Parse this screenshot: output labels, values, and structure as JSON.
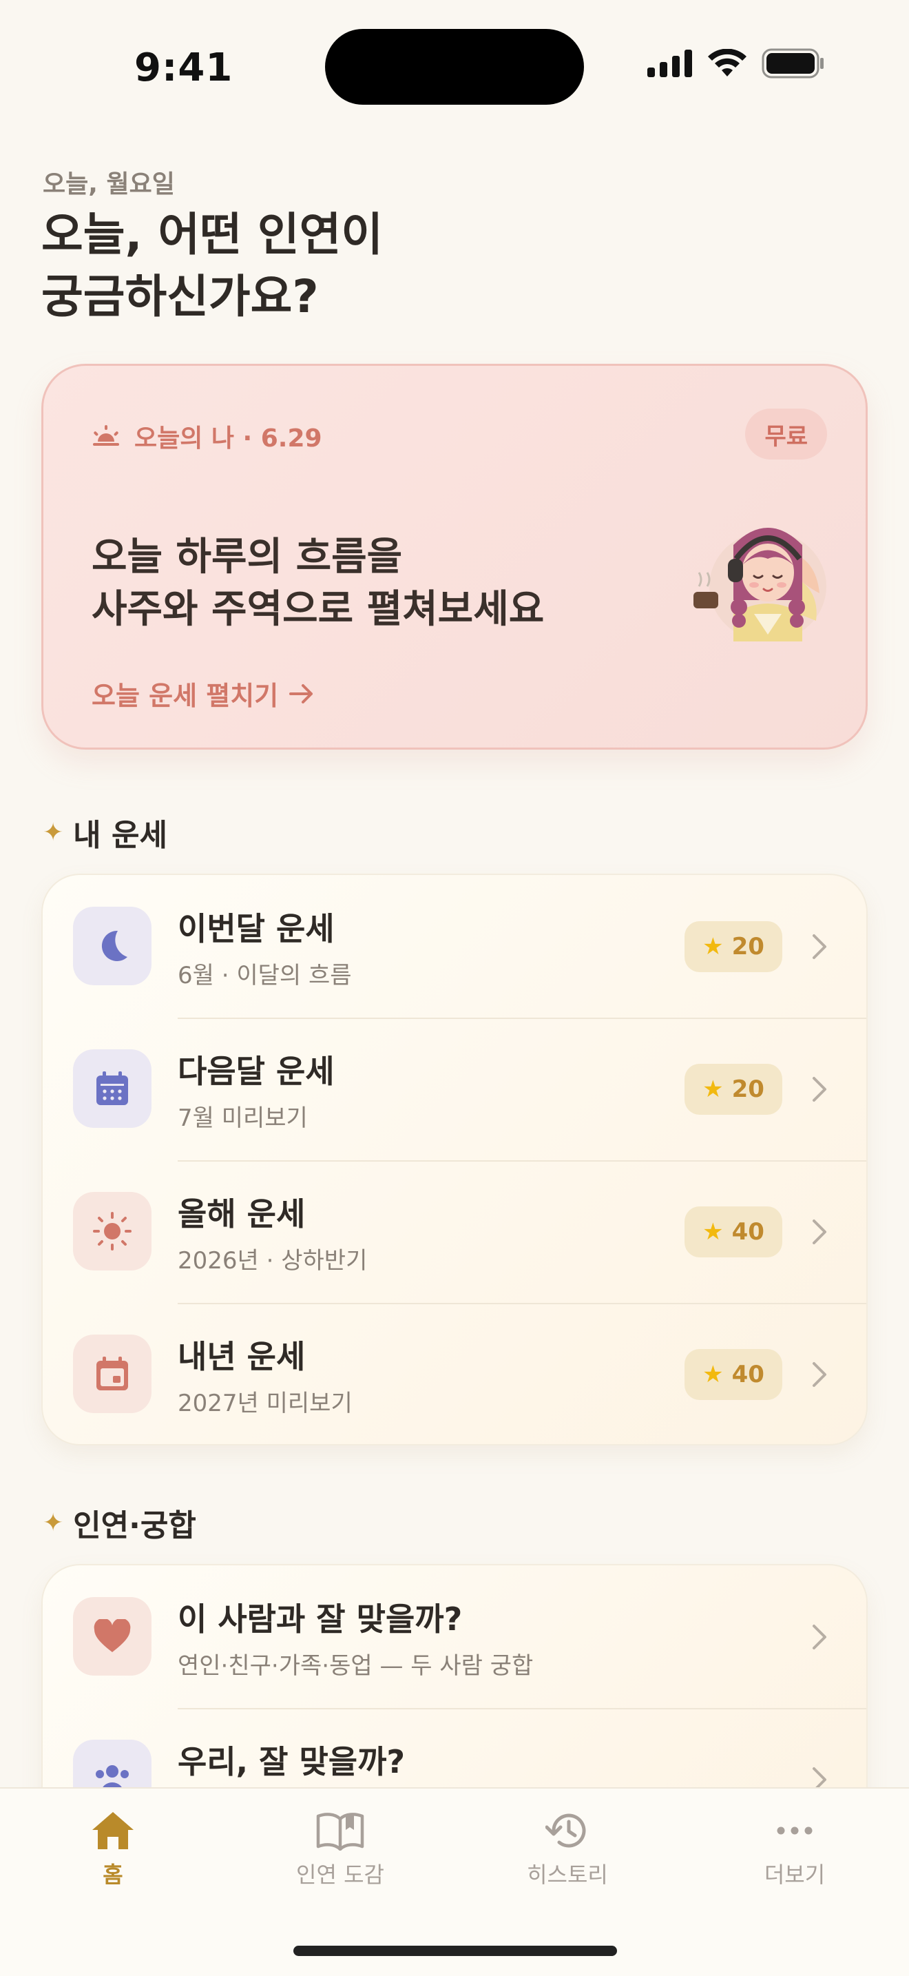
{
  "status_bar": {
    "time": "9:41"
  },
  "header": {
    "date_label": "오늘, 월요일",
    "headline": "오늘, 어떤 인연이\n궁금하신가요?"
  },
  "today_card": {
    "tag": "오늘의 나 · 6.29",
    "badge": "무료",
    "title": "오늘 하루의 흐름을\n사주와 주역으로 펼쳐보세요",
    "cta": "오늘 운세 펼치기"
  },
  "my_fortune": {
    "section_title": "내 운세",
    "items": [
      {
        "title": "이번달 운세",
        "subtitle": "6월 · 이달의 흐름",
        "cost": "20",
        "icon": "moon-icon"
      },
      {
        "title": "다음달 운세",
        "subtitle": "7월 미리보기",
        "cost": "20",
        "icon": "calendar-icon"
      },
      {
        "title": "올해 운세",
        "subtitle": "2026년 · 상하반기",
        "cost": "40",
        "icon": "sun-icon"
      },
      {
        "title": "내년 운세",
        "subtitle": "2027년 미리보기",
        "cost": "40",
        "icon": "calendar-date-icon"
      }
    ]
  },
  "compat": {
    "section_title": "인연·궁합",
    "items": [
      {
        "title": "이 사람과 잘 맞을까?",
        "subtitle": "연인·친구·가족·동업 — 두 사람 궁합",
        "icon": "heart-icon"
      },
      {
        "title": "우리, 잘 맞을까?",
        "subtitle": "",
        "icon": "group-icon"
      }
    ]
  },
  "tabs": [
    {
      "label": "홈",
      "icon": "home-icon",
      "active": true
    },
    {
      "label": "인연 도감",
      "icon": "book-icon",
      "active": false
    },
    {
      "label": "히스토리",
      "icon": "history-icon",
      "active": false
    },
    {
      "label": "더보기",
      "icon": "more-icon",
      "active": false
    }
  ],
  "colors": {
    "accent": "#b98a2a",
    "coral": "#d17768",
    "indigo": "#6b72c4",
    "background": "#faf7f1"
  }
}
